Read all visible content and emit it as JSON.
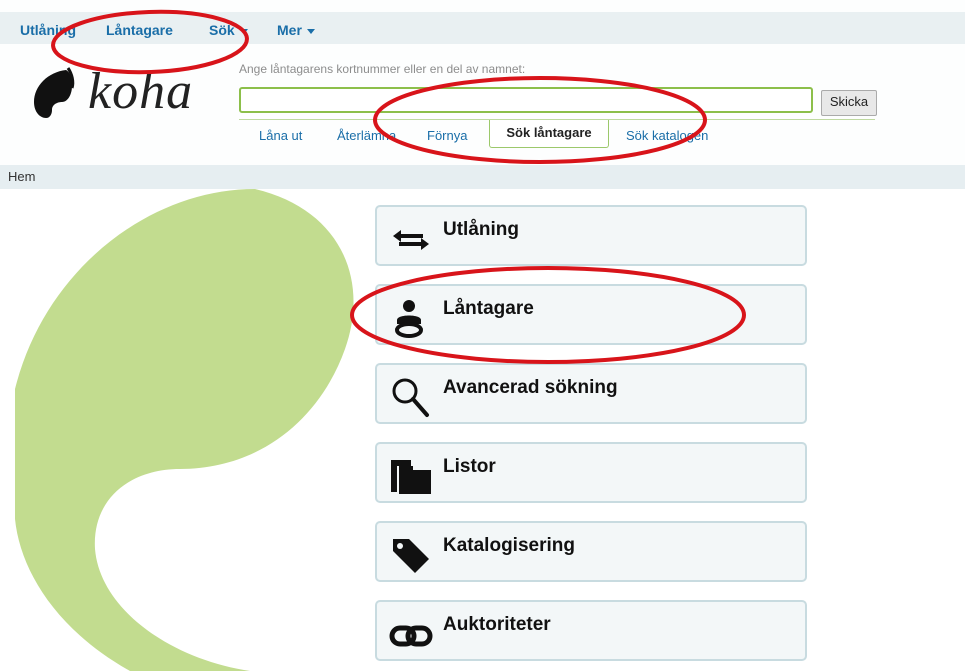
{
  "topnav": {
    "items": [
      {
        "label": "Utlåning",
        "dropdown": false
      },
      {
        "label": "Låntagare",
        "dropdown": false
      },
      {
        "label": "Sök",
        "dropdown": true
      },
      {
        "label": "Mer",
        "dropdown": true
      }
    ]
  },
  "logo": {
    "text": "koha"
  },
  "search": {
    "hint": "Ange låntagarens kortnummer eller en del av namnet:",
    "value": "",
    "submit_label": "Skicka"
  },
  "tabs": [
    {
      "label": "Låna ut",
      "active": false
    },
    {
      "label": "Återlämna",
      "active": false
    },
    {
      "label": "Förnya",
      "active": false
    },
    {
      "label": "Sök låntagare",
      "active": true
    },
    {
      "label": "Sök katalogen",
      "active": false
    }
  ],
  "breadcrumb": {
    "home": "Hem"
  },
  "modules": [
    {
      "label": "Utlåning",
      "icon": "exchange-arrows-icon"
    },
    {
      "label": "Låntagare",
      "icon": "patron-icon"
    },
    {
      "label": "Avancerad sökning",
      "icon": "magnifier-icon"
    },
    {
      "label": "Listor",
      "icon": "folders-icon"
    },
    {
      "label": "Katalogisering",
      "icon": "tag-icon"
    },
    {
      "label": "Auktoriteter",
      "icon": "chain-link-icon"
    }
  ],
  "colors": {
    "link": "#1a6ea8",
    "accent_green": "#8cbf4a",
    "leaf_green": "#c2dc8f",
    "annotation_red": "#d8141a"
  }
}
